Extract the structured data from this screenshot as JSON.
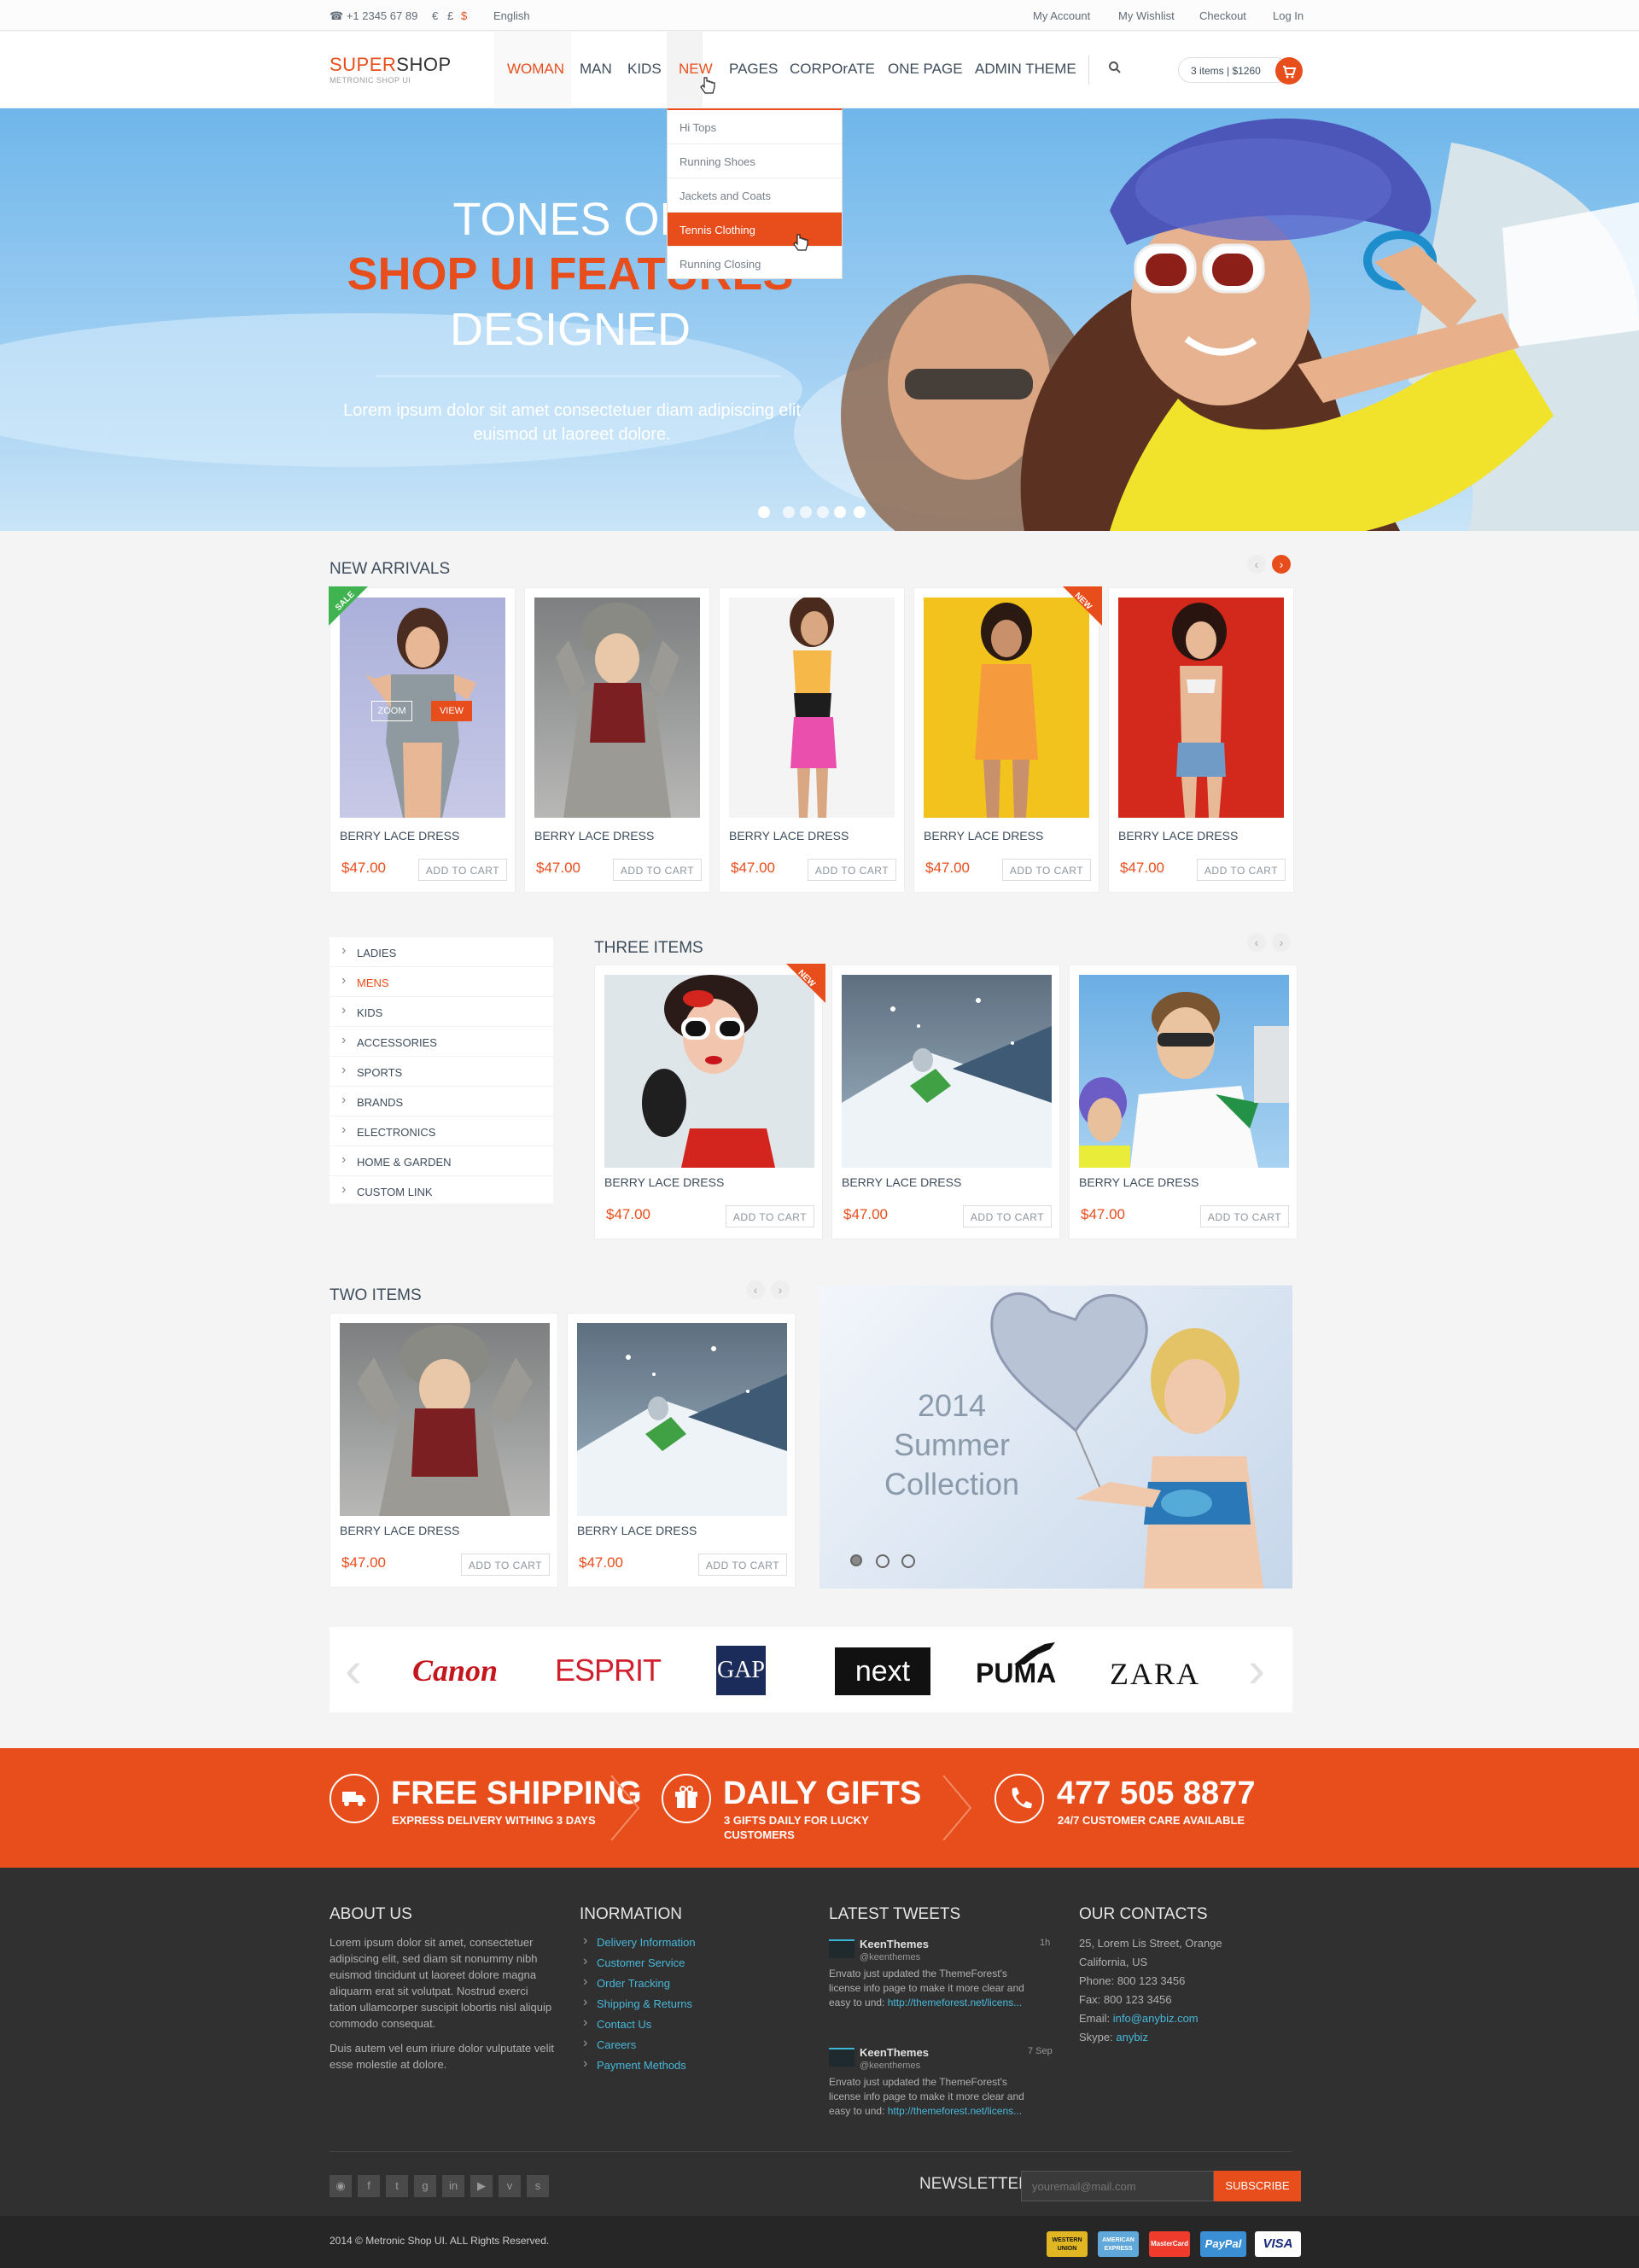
{
  "topbar": {
    "phone": "+1 2345 67 89",
    "currencies": [
      "€",
      "£",
      "$"
    ],
    "language": "English",
    "links": [
      "My Account",
      "My Wishlist",
      "Checkout",
      "Log In"
    ]
  },
  "header": {
    "logo_brand": "SUPER",
    "logo_brand2": "SHOP",
    "logo_sub": "METRONIC SHOP UI",
    "nav": [
      "WOMAN",
      "MAN",
      "KIDS",
      "NEW",
      "PAGES",
      "CORPOrATE",
      "ONE PAGE",
      "ADMIN THEME"
    ],
    "cart_text": "3 items | $1260"
  },
  "dropdown": [
    "Hi Tops",
    "Running Shoes",
    "Jackets and Coats",
    "Tennis Clothing",
    "Running Closing"
  ],
  "hero": {
    "line1": "TONES OF",
    "line2": "SHOP UI FEATURES",
    "line3": "DESIGNED",
    "text": "Lorem ipsum dolor sit amet  consectetuer diam adipiscing elit euismod ut laoreet dolore."
  },
  "new_arrivals": {
    "title": "NEW ARRIVALS",
    "zoom_label": "ZOOM",
    "view_label": "VIEW",
    "badge_sale": "SALE",
    "badge_new": "NEW",
    "products": [
      {
        "name": "BERRY LACE DRESS",
        "price": "$47.00"
      },
      {
        "name": "BERRY LACE DRESS",
        "price": "$47.00"
      },
      {
        "name": "BERRY LACE DRESS",
        "price": "$47.00"
      },
      {
        "name": "BERRY LACE DRESS",
        "price": "$47.00"
      },
      {
        "name": "BERRY LACE DRESS",
        "price": "$47.00"
      }
    ],
    "add_to_cart": "ADD TO CART"
  },
  "sidebar": [
    "LADIES",
    "MENS",
    "KIDS",
    "ACCESSORIES",
    "SPORTS",
    "BRANDS",
    "ELECTRONICS",
    "HOME & GARDEN",
    "CUSTOM LINK"
  ],
  "three_items": {
    "title": "THREE ITEMS",
    "products": [
      {
        "name": "BERRY LACE DRESS",
        "price": "$47.00"
      },
      {
        "name": "BERRY LACE DRESS",
        "price": "$47.00"
      },
      {
        "name": "BERRY LACE DRESS",
        "price": "$47.00"
      }
    ]
  },
  "two_items": {
    "title": "TWO ITEMS",
    "products": [
      {
        "name": "BERRY LACE DRESS",
        "price": "$47.00"
      },
      {
        "name": "BERRY LACE DRESS",
        "price": "$47.00"
      }
    ]
  },
  "summer": {
    "l1": "2014",
    "l2": "Summer",
    "l3": "Collection"
  },
  "brands": [
    "Canon",
    "ESPRIT",
    "GAP",
    "next",
    "PUMA",
    "ZARA"
  ],
  "promo": [
    {
      "title": "FREE SHIPPING",
      "sub": "EXPRESS DELIVERY WITHING 3 DAYS"
    },
    {
      "title": "DAILY GIFTS",
      "sub": "3 GIFTS DAILY FOR LUCKY",
      "sub2": "CUSTOMERS"
    },
    {
      "title": "477 505 8877",
      "sub": "24/7 CUSTOMER CARE AVAILABLE"
    }
  ],
  "footer": {
    "about_title": "ABOUT US",
    "about_p1": "Lorem ipsum dolor sit amet, consectetuer adipiscing elit, sed diam sit nonummy nibh euismod tincidunt ut laoreet dolore magna aliquarm erat sit volutpat. Nostrud exerci tation ullamcorper suscipit lobortis nisl aliquip  commodo consequat.",
    "about_p2": "Duis autem vel eum iriure dolor vulputate velit esse molestie at dolore.",
    "info_title": "INORMATION",
    "info_links": [
      "Delivery Information",
      "Customer Service",
      "Order Tracking",
      "Shipping & Returns",
      "Contact Us",
      "Careers",
      "Payment Methods"
    ],
    "tweets_title": "LATEST TWEETS",
    "tweets": [
      {
        "user": "KeenThemes",
        "handle": "@keenthemes",
        "time": "1h",
        "text": "Envato just updated the ThemeForest's license info page to make it more clear and easy to und:",
        "link": "http://themeforest.net/licens..."
      },
      {
        "user": "KeenThemes",
        "handle": "@keenthemes",
        "time": "7 Sep",
        "text": "Envato just updated the ThemeForest's license info page to make it more clear and easy to und:",
        "link": "http://themeforest.net/licens..."
      }
    ],
    "contacts_title": "OUR CONTACTS",
    "address1": "25, Lorem Lis Street, Orange",
    "address2": "California, US",
    "phone": "Phone: 800 123 3456",
    "fax": "Fax: 800 123 3456",
    "email_label": "Email: ",
    "email": "info@anybiz.com",
    "skype_label": "Skype: ",
    "skype": "anybiz",
    "newsletter_label": "NEWSLETTER",
    "newsletter_placeholder": "youremail@mail.com",
    "subscribe": "SUBSCRIBE",
    "copyright": "2014 © Metronic Shop UI. ALL Rights Reserved.",
    "payments": [
      "WESTERN UNION",
      "AMERICAN EXPRESS",
      "MasterCard",
      "PayPal",
      "VISA"
    ]
  },
  "colors": {
    "accent": "#e84d1c",
    "footer_bg": "#313030",
    "link": "#46b8da"
  }
}
